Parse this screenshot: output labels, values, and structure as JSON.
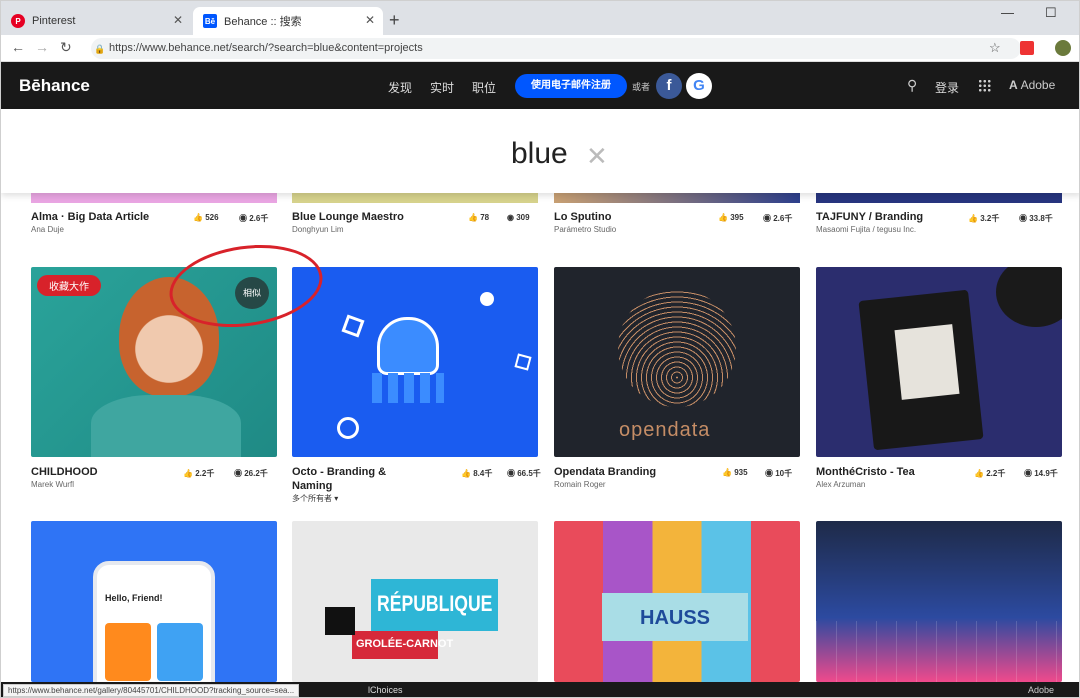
{
  "browser": {
    "tabs": [
      {
        "title": "Pinterest",
        "favicon": "pinterest-icon",
        "color": "#e60023"
      },
      {
        "title": "Behance :: 搜索",
        "favicon": "behance-icon",
        "color": "#0057ff"
      }
    ],
    "url": "https://www.behance.net/search/?search=blue&content=projects"
  },
  "navbar": {
    "logo": "Bēhance",
    "links": [
      "发现",
      "实时",
      "职位"
    ],
    "signup": "使用电子邮件注册",
    "or": "或者",
    "login": "登录",
    "adobe": "Adobe"
  },
  "search": {
    "query": "blue"
  },
  "row1": [
    {
      "title": "Alma · Big Data Article",
      "owner": "Ana Duje",
      "likes": "526",
      "views": "2.6千"
    },
    {
      "title": "Blue Lounge Maestro",
      "owner": "Donghyun Lim",
      "likes": "78",
      "views": "309"
    },
    {
      "title": "Lo Sputino",
      "owner": "Parámetro Studio",
      "likes": "395",
      "views": "2.6千"
    },
    {
      "title": "TAJFUNY / Branding",
      "owner": "Masaomi Fujita / tegusu Inc.",
      "likes": "3.2千",
      "views": "33.8千"
    }
  ],
  "row2": [
    {
      "title": "CHILDHOOD",
      "owner": "Marek Wurfl",
      "likes": "2.2千",
      "views": "26.2千"
    },
    {
      "title": "Octo - Branding & Naming",
      "owner": "",
      "likes": "8.4千",
      "views": "66.5千"
    },
    {
      "title": "Opendata Branding",
      "owner": "Romain Roger",
      "likes": "935",
      "views": "10千"
    },
    {
      "title": "MonthéCristo - Tea",
      "owner": "Alex Arzuman",
      "likes": "2.2千",
      "views": "14.9千"
    }
  ],
  "octo_owners": "多个所有者",
  "badge": "收藏大作",
  "similar": "相似",
  "thumb_texts": {
    "opendata": "opendata",
    "hello": "Hello, Friend!",
    "republique": "RÉPUBLIQUE",
    "grolee": "GROLÉE-CARNOT",
    "hauss": "HAUSS"
  },
  "status": {
    "url": "https://www.behance.net/gallery/80445701/CHILDHOOD?tracking_source=sea...",
    "text": "lChoices",
    "adobe": "Adobe"
  }
}
